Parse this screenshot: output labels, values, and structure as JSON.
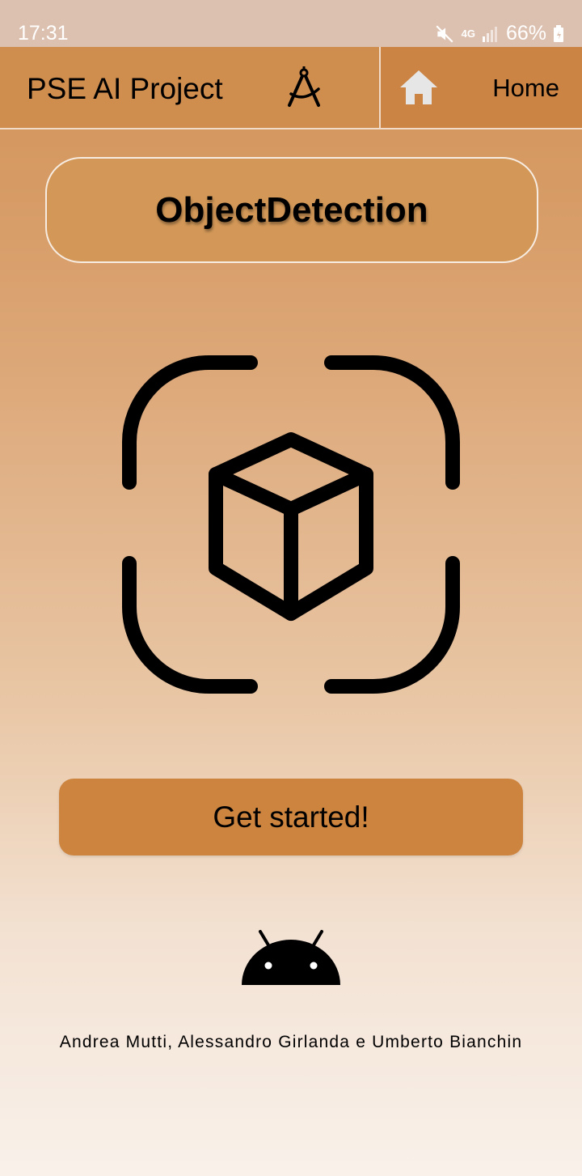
{
  "status_bar": {
    "time": "17:31",
    "network": "4G",
    "battery": "66%",
    "icons": [
      "mute-icon",
      "network-4g-icon",
      "signal-icon",
      "battery-icon"
    ]
  },
  "app_bar": {
    "title": "PSE AI Project",
    "title_icon": "compass-icon",
    "home_icon": "home-icon",
    "home_label": "Home"
  },
  "main": {
    "feature_title": "ObjectDetection",
    "hero_icon": "object-scan-icon",
    "cta_label": "Get started!",
    "footer_icon": "android-icon",
    "credits": "Andrea Mutti, Alessandro Girlanda e Umberto Bianchin"
  },
  "colors": {
    "app_bar": "#cf8d4e",
    "home_area": "#cb8443",
    "button": "#cd843f",
    "status_bar": "#dcc0b0"
  }
}
